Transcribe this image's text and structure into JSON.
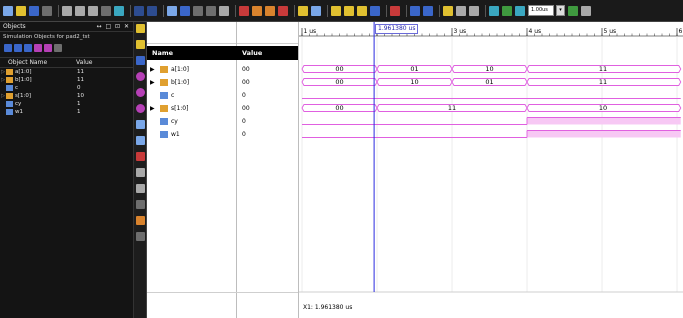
{
  "toolbar": {
    "zoom_value": "1.00us",
    "zoom_dropdown": "▾"
  },
  "objects_panel": {
    "title": "Objects",
    "controls": "↔ □ ⊡ ✕",
    "subtitle": "Simulation Objects for pad2_tst",
    "col_name": "Object Name",
    "col_value": "Value",
    "rows": [
      {
        "name": "a[1:0]",
        "value": "11"
      },
      {
        "name": "b[1:0]",
        "value": "11"
      },
      {
        "name": "c",
        "value": "0"
      },
      {
        "name": "s[1:0]",
        "value": "10"
      },
      {
        "name": "cy",
        "value": "1"
      },
      {
        "name": "w1",
        "value": "1"
      }
    ]
  },
  "names_panel": {
    "col_name": "Name",
    "col_value": "Value",
    "rows": [
      {
        "name": "a[1:0]",
        "value": "00",
        "expander": "▶",
        "kind": "bus"
      },
      {
        "name": "b[1:0]",
        "value": "00",
        "expander": "▶",
        "kind": "bus"
      },
      {
        "name": "c",
        "value": "0",
        "expander": "",
        "kind": "bit"
      },
      {
        "name": "s[1:0]",
        "value": "00",
        "expander": "▶",
        "kind": "bus"
      },
      {
        "name": "cy",
        "value": "0",
        "expander": "",
        "kind": "bit"
      },
      {
        "name": "w1",
        "value": "0",
        "expander": "",
        "kind": "bit"
      }
    ]
  },
  "wave": {
    "cursor_time": "1.961380 us",
    "cursor_readout": "X1: 1.961380 us",
    "time_ticks": [
      {
        "label": "1 us",
        "t": 1
      },
      {
        "label": "2 us",
        "t": 2
      },
      {
        "label": "3 us",
        "t": 3
      },
      {
        "label": "4 us",
        "t": 4
      },
      {
        "label": "5 us",
        "t": 5
      },
      {
        "label": "6 us",
        "t": 6
      }
    ],
    "cursor_t": 1.96138,
    "signals": [
      {
        "name": "a[1:0]",
        "kind": "bus",
        "segments": [
          {
            "t0": 1,
            "t1": 2,
            "label": "00"
          },
          {
            "t0": 2,
            "t1": 3,
            "label": "01"
          },
          {
            "t0": 3,
            "t1": 4,
            "label": "10"
          },
          {
            "t0": 4,
            "t1": 6.05,
            "label": "11"
          }
        ]
      },
      {
        "name": "b[1:0]",
        "kind": "bus",
        "segments": [
          {
            "t0": 1,
            "t1": 2,
            "label": "00"
          },
          {
            "t0": 2,
            "t1": 3,
            "label": "10"
          },
          {
            "t0": 3,
            "t1": 4,
            "label": "01"
          },
          {
            "t0": 4,
            "t1": 6.05,
            "label": "11"
          }
        ]
      },
      {
        "name": "c",
        "kind": "bit",
        "levels": [
          {
            "t0": 1,
            "t1": 6.05,
            "v": 0
          }
        ]
      },
      {
        "name": "s[1:0]",
        "kind": "bus",
        "segments": [
          {
            "t0": 1,
            "t1": 2,
            "label": "00"
          },
          {
            "t0": 2,
            "t1": 4,
            "label": "11"
          },
          {
            "t0": 4,
            "t1": 6.05,
            "label": "10"
          }
        ]
      },
      {
        "name": "cy",
        "kind": "bit",
        "levels": [
          {
            "t0": 1,
            "t1": 4,
            "v": 0
          },
          {
            "t0": 4,
            "t1": 6.05,
            "v": 1
          }
        ]
      },
      {
        "name": "w1",
        "kind": "bit",
        "levels": [
          {
            "t0": 1,
            "t1": 4,
            "v": 0
          },
          {
            "t0": 4,
            "t1": 6.05,
            "v": 1
          }
        ]
      }
    ]
  },
  "colors": {
    "wave": "#e060e0",
    "wave_fill": "#f7c8f4",
    "cursor": "#2a2ae0",
    "grid": "#d8d8d8"
  }
}
